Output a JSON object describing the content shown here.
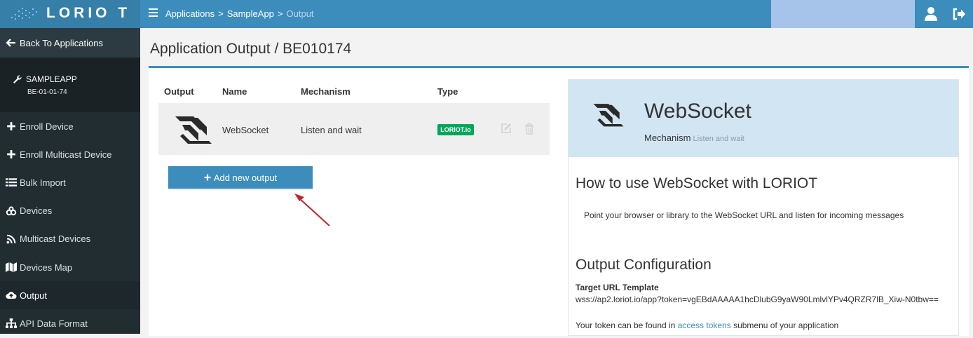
{
  "brand": {
    "logo_text": "LORIO T"
  },
  "breadcrumb": {
    "items": [
      "Applications",
      "SampleApp"
    ],
    "separator": ">",
    "current": "Output"
  },
  "sidebar": {
    "back_label": "Back To Applications",
    "app_name": "SAMPLEAPP",
    "app_id": "BE-01-01-74",
    "items": [
      {
        "label": "Enroll Device",
        "icon": "plus-icon"
      },
      {
        "label": "Enroll Multicast Device",
        "icon": "plus-icon"
      },
      {
        "label": "Bulk Import",
        "icon": "list-icon"
      },
      {
        "label": "Devices",
        "icon": "devices-icon"
      },
      {
        "label": "Multicast Devices",
        "icon": "rss-icon"
      },
      {
        "label": "Devices Map",
        "icon": "map-icon"
      },
      {
        "label": "Output",
        "icon": "cloud-upload-icon",
        "active": true
      },
      {
        "label": "API Data Format",
        "icon": "sitemap-icon"
      }
    ]
  },
  "page": {
    "title": "Application Output / BE010174"
  },
  "table": {
    "headers": [
      "Output",
      "Name",
      "Mechanism",
      "Type"
    ],
    "rows": [
      {
        "name": "WebSocket",
        "mechanism": "Listen and wait",
        "type": "LORIOT.io"
      }
    ]
  },
  "add_button_label": "Add new output",
  "panel": {
    "title": "WebSocket",
    "mechanism_label": "Mechanism",
    "mechanism_value": "Listen and wait",
    "howto_title": "How to use WebSocket with LORIOT",
    "howto_text": "Point your browser or library to the WebSocket URL and listen for incoming messages",
    "config_title": "Output Configuration",
    "target_label": "Target URL Template",
    "target_url": "wss://ap2.loriot.io/app?token=vgEBdAAAAA1hcDlubG9yaW90LmlvlYPv4QRZR7lB_Xiw-N0tbw==",
    "token_prefix": "Your token can be found in",
    "token_link": "access tokens",
    "token_suffix": "submenu of your application"
  },
  "colors": {
    "accent": "#3c8dbc",
    "sidebar": "#222d32",
    "badge": "#00a65a",
    "panel_head": "#d2e5f3",
    "arrow": "#c0242a"
  }
}
